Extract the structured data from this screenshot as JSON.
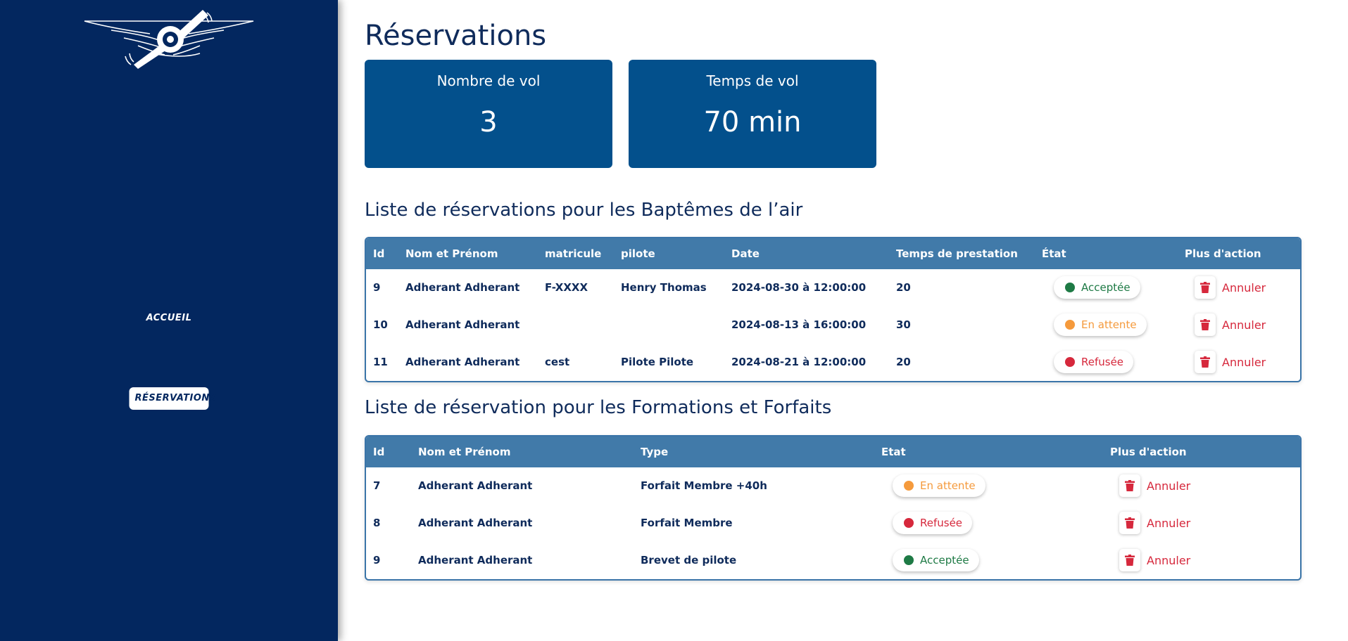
{
  "nav": {
    "home_label": "ACCUEIL",
    "reservations_label": "RÉSERVATIONS"
  },
  "page": {
    "title": "Réservations"
  },
  "stats": {
    "flights_label": "Nombre de vol",
    "flights_value": "3",
    "time_label": "Temps de vol",
    "time_value": "70 min"
  },
  "baptemes": {
    "title": "Liste de réservations pour les Baptêmes de l’air",
    "headers": [
      "Id",
      "Nom et Prénom",
      "matricule",
      "pilote",
      "Date",
      "Temps de prestation",
      "État",
      "Plus d'action"
    ],
    "rows": [
      {
        "id": "9",
        "name": "Adherant Adherant",
        "matricule": "F-XXXX",
        "pilote": "Henry Thomas",
        "date": "2024-08-30 à 12:00:00",
        "temps": "20",
        "etat": "Acceptée",
        "action": "Annuler"
      },
      {
        "id": "10",
        "name": "Adherant Adherant",
        "matricule": "",
        "pilote": "",
        "date": "2024-08-13 à 16:00:00",
        "temps": "30",
        "etat": "En attente",
        "action": "Annuler"
      },
      {
        "id": "11",
        "name": "Adherant Adherant",
        "matricule": "cest",
        "pilote": "Pilote Pilote",
        "date": "2024-08-21 à 12:00:00",
        "temps": "20",
        "etat": "Refusée",
        "action": "Annuler"
      }
    ]
  },
  "formations": {
    "title": "Liste de réservation pour les Formations et Forfaits",
    "headers": [
      "Id",
      "Nom et Prénom",
      "Type",
      "Etat",
      "Plus d'action"
    ],
    "rows": [
      {
        "id": "7",
        "name": "Adherant Adherant",
        "type": "Forfait Membre +40h",
        "etat": "En attente",
        "action": "Annuler"
      },
      {
        "id": "8",
        "name": "Adherant Adherant",
        "type": "Forfait Membre",
        "etat": "Refusée",
        "action": "Annuler"
      },
      {
        "id": "9",
        "name": "Adherant Adherant",
        "type": "Brevet de pilote",
        "etat": "Acceptée",
        "action": "Annuler"
      }
    ]
  },
  "colors": {
    "sidebar": "#03275f",
    "card": "#03508c",
    "table_header": "#417aa9",
    "accepted": "#1e7a45",
    "pending": "#f59a3c",
    "refused": "#d6283c"
  },
  "icons": {
    "logo": "winged-propeller-logo",
    "delete": "trash-icon"
  }
}
